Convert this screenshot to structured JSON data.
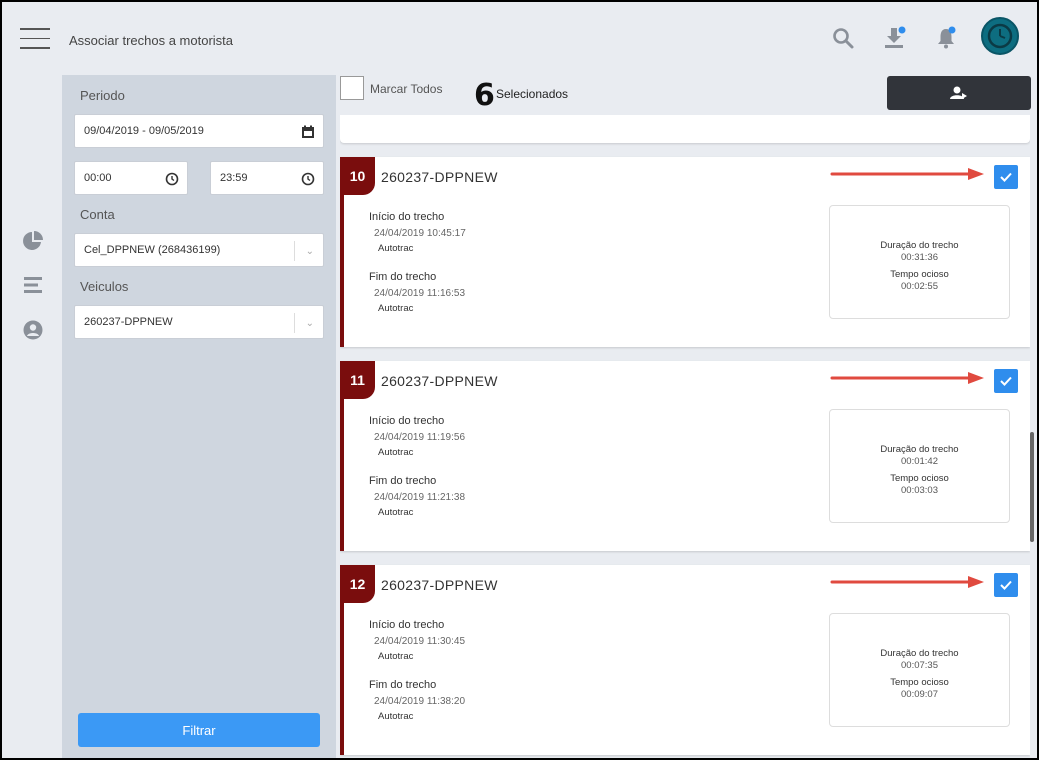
{
  "header": {
    "title": "Associar trechos a motorista",
    "icons": [
      "menu-icon",
      "search-icon",
      "download-icon",
      "bell-icon",
      "avatar"
    ],
    "notification_color": "#2f8ded"
  },
  "filters": {
    "period_label": "Periodo",
    "period_value": "09/04/2019 - 09/05/2019",
    "time_start": "00:00",
    "time_end": "23:59",
    "account_label": "Conta",
    "account_value": "Cel_DPPNEW (268436199)",
    "vehicles_label": "Veiculos",
    "vehicles_value": "260237-DPPNEW",
    "filter_button": "Filtrar"
  },
  "toolbar": {
    "select_all_label": "Marcar Todos",
    "selected_count": "6",
    "selected_label": "Selecionados"
  },
  "colors": {
    "accent_blue": "#3b99f5",
    "card_accent": "#7a0d0d",
    "arrow_red": "#e04a3f",
    "dark_button": "#31343a"
  },
  "cards": [
    {
      "index": "10",
      "title": "260237-DPPNEW",
      "start_label": "Início do trecho",
      "start_datetime": "24/04/2019 10:45:17",
      "start_source": "Autotrac",
      "end_label": "Fim do trecho",
      "end_datetime": "24/04/2019 11:16:53",
      "end_source": "Autotrac",
      "duration_label": "Duração do trecho",
      "duration_value": "00:31:36",
      "idle_label": "Tempo ocioso",
      "idle_value": "00:02:55",
      "checked": true
    },
    {
      "index": "11",
      "title": "260237-DPPNEW",
      "start_label": "Início do trecho",
      "start_datetime": "24/04/2019 11:19:56",
      "start_source": "Autotrac",
      "end_label": "Fim do trecho",
      "end_datetime": "24/04/2019 11:21:38",
      "end_source": "Autotrac",
      "duration_label": "Duração do trecho",
      "duration_value": "00:01:42",
      "idle_label": "Tempo ocioso",
      "idle_value": "00:03:03",
      "checked": true
    },
    {
      "index": "12",
      "title": "260237-DPPNEW",
      "start_label": "Início do trecho",
      "start_datetime": "24/04/2019 11:30:45",
      "start_source": "Autotrac",
      "end_label": "Fim do trecho",
      "end_datetime": "24/04/2019 11:38:20",
      "end_source": "Autotrac",
      "duration_label": "Duração do trecho",
      "duration_value": "00:07:35",
      "idle_label": "Tempo ocioso",
      "idle_value": "00:09:07",
      "checked": true
    }
  ]
}
